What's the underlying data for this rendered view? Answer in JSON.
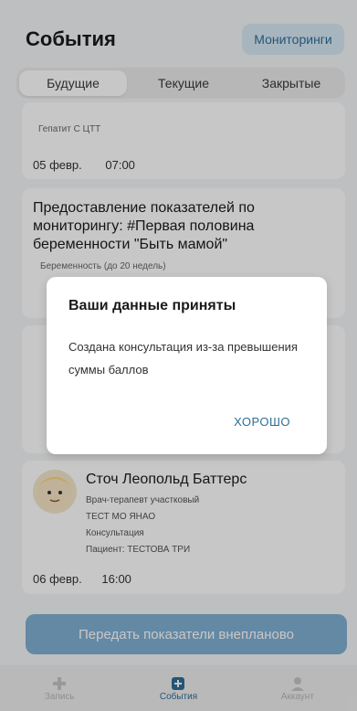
{
  "header": {
    "title": "События",
    "monitoring_button": "Мониторинги"
  },
  "tabs": [
    "Будущие",
    "Текущие",
    "Закрытые"
  ],
  "cards": [
    {
      "subtitle": "Гепатит С ЦТТ",
      "date": "05 февр.",
      "time": "07:00"
    },
    {
      "title_lines": [
        "Предоставление показателей по",
        "мониторингу: #Первая половина",
        "беременности \"Быть мамой\""
      ],
      "subtitle": "Беременность (до 20 недель)"
    }
  ],
  "doctor": {
    "name": "Сточ Леопольд Баттерс",
    "role": "Врач-терапевт участковый",
    "org": "ТЕСТ МО ЯНАО",
    "type": "Консультация",
    "patient": "Пациент: ТЕСТОВА ТРИ",
    "date": "06 февр.",
    "time": "16:00"
  },
  "bottom_button": "Передать показатели внепланово",
  "nav": [
    {
      "label": "Запись",
      "icon": "plus-icon"
    },
    {
      "label": "События",
      "icon": "events-icon"
    },
    {
      "label": "Аккаунт",
      "icon": "user-icon"
    }
  ],
  "dialog": {
    "title": "Ваши данные приняты",
    "message": "Создана консультация из-за превышения суммы баллов",
    "ok": "ХОРОШО"
  },
  "colors": {
    "accent": "#2f6e97",
    "button": "#7fb0d4"
  }
}
